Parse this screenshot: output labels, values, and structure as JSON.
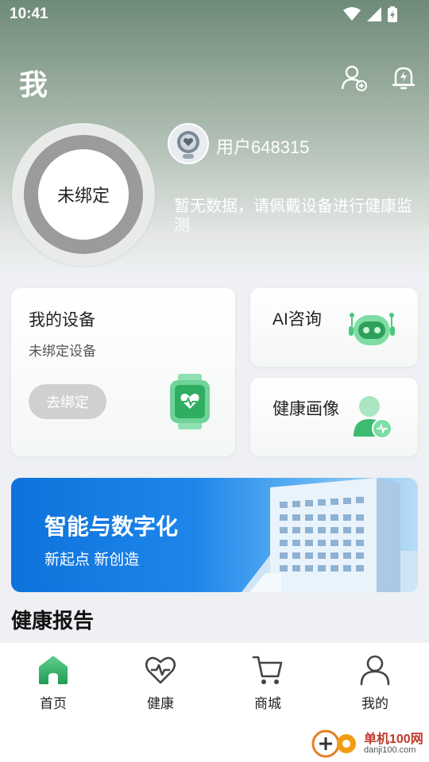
{
  "status_bar": {
    "time": "10:41"
  },
  "header": {
    "title": "我"
  },
  "device_ring": {
    "label": "未绑定"
  },
  "profile": {
    "username": "用户648315",
    "message": "暂无数据，请佩戴设备进行健康监测"
  },
  "cards": {
    "my_device": {
      "title": "我的设备",
      "subtitle": "未绑定设备",
      "button": "去绑定"
    },
    "ai_consult": {
      "title": "AI咨询"
    },
    "health_profile": {
      "title": "健康画像"
    }
  },
  "banner": {
    "title": "智能与数字化",
    "subtitle": "新起点 新创造"
  },
  "section": {
    "health_report": "健康报告"
  },
  "bottom_nav": [
    {
      "label": "首页",
      "icon": "home-icon",
      "active": true
    },
    {
      "label": "健康",
      "icon": "heart-pulse-icon",
      "active": false
    },
    {
      "label": "商城",
      "icon": "cart-icon",
      "active": false
    },
    {
      "label": "我的",
      "icon": "person-icon",
      "active": false
    }
  ],
  "watermark": {
    "name": "单机100网",
    "url": "danji100.com"
  },
  "colors": {
    "accent_green": "#2fae62",
    "banner_blue": "#0d73dc"
  }
}
